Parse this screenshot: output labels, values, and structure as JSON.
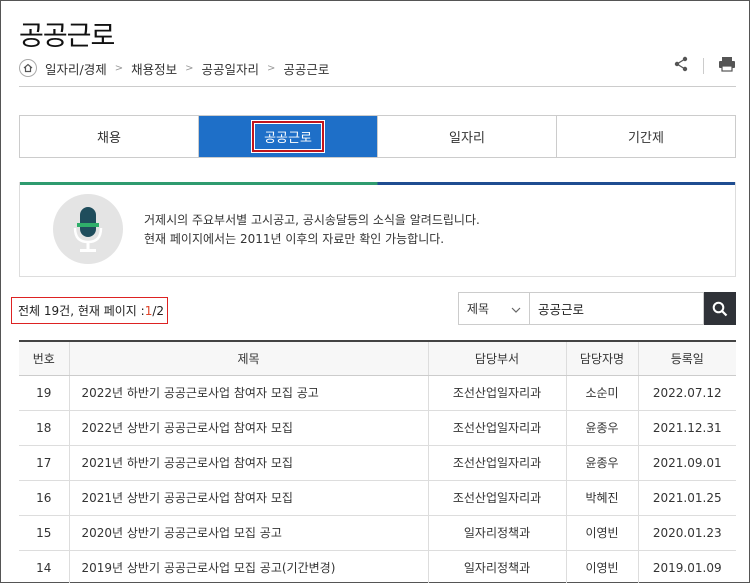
{
  "page": {
    "title": "공공근로"
  },
  "breadcrumb": [
    "일자리/경제",
    "채용정보",
    "공공일자리",
    "공공근로"
  ],
  "tools": {
    "share_icon": "share-icon",
    "print_icon": "print-icon"
  },
  "tabs": [
    {
      "label": "채용",
      "active": false
    },
    {
      "label": "공공근로",
      "active": true
    },
    {
      "label": "일자리",
      "active": false
    },
    {
      "label": "기간제",
      "active": false
    }
  ],
  "info": {
    "line1": "거제시의 주요부서별 고시공고, 공시송달등의 소식을 알려드립니다.",
    "line2": "현재 페이지에서는 2011년 이후의 자료만 확인 가능합니다."
  },
  "summary": {
    "prefix": "전체 19건, 현재 페이지 : ",
    "current": "1",
    "total": "/2"
  },
  "search": {
    "select_value": "제목",
    "input_value": "공공근로"
  },
  "table": {
    "headers": [
      "번호",
      "제목",
      "담당부서",
      "담당자명",
      "등록일"
    ],
    "rows": [
      [
        "19",
        "2022년 하반기 공공근로사업 참여자 모집 공고",
        "조선산업일자리과",
        "소순미",
        "2022.07.12"
      ],
      [
        "18",
        "2022년 상반기 공공근로사업 참여자 모집",
        "조선산업일자리과",
        "윤종우",
        "2021.12.31"
      ],
      [
        "17",
        "2021년 하반기 공공근로사업 참여자 모집",
        "조선산업일자리과",
        "윤종우",
        "2021.09.01"
      ],
      [
        "16",
        "2021년 상반기 공공근로사업 참여자 모집",
        "조선산업일자리과",
        "박혜진",
        "2021.01.25"
      ],
      [
        "15",
        "2020년 상반기 공공근로사업 모집 공고",
        "일자리정책과",
        "이영빈",
        "2020.01.23"
      ],
      [
        "14",
        "2019년 상반기 공공근로사업 모집 공고(기간변경)",
        "일자리정책과",
        "이영빈",
        "2019.01.09"
      ]
    ]
  },
  "colors": {
    "tab_active": "#1e6fc8",
    "highlight_box": "#dd2222",
    "current_page": "#e0452a",
    "search_button": "#2f3238"
  }
}
